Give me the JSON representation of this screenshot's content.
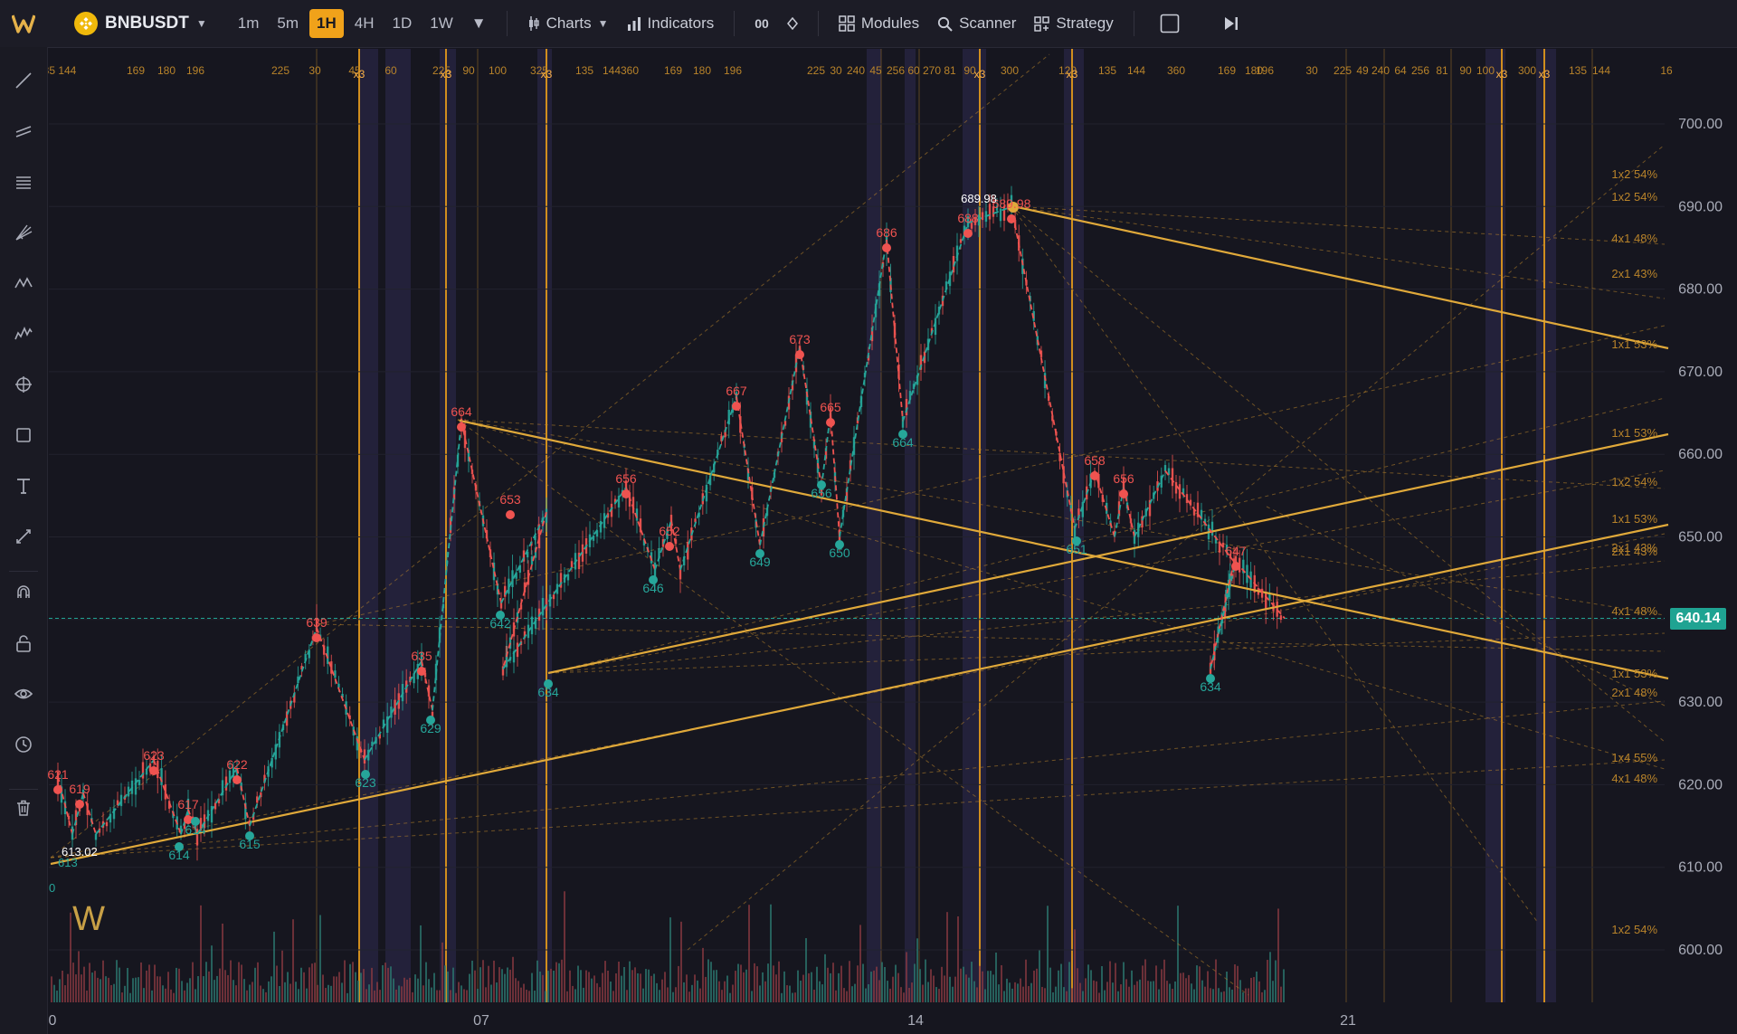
{
  "symbol": "BNBUSDT",
  "timeframes": [
    "1m",
    "5m",
    "1H",
    "4H",
    "1D",
    "1W"
  ],
  "active_timeframe": "1H",
  "toolbar": {
    "charts_label": "Charts",
    "indicators_label": "Indicators",
    "compare_glyph": "00",
    "modules_label": "Modules",
    "scanner_label": "Scanner",
    "strategy_label": "Strategy"
  },
  "sidebar_icons": [
    "trend-line-icon",
    "parallel-channel-icon",
    "horizontal-lines-icon",
    "pitchfork-icon",
    "zigzag-pattern-icon",
    "wave-pattern-icon",
    "crosshair-icon",
    "rectangle-icon",
    "text-tool-icon",
    "measure-icon",
    "magnet-icon",
    "lock-icon",
    "visibility-icon",
    "clock-icon",
    "trash-icon"
  ],
  "colors": {
    "background": "#16161f",
    "accent_orange": "#f0a21a",
    "bull": "#26a69a",
    "bear": "#ef5350",
    "price_badge": "#1fa392",
    "gann_label": "#b8832a"
  },
  "watermark_logo": "W",
  "current_price": "640.14",
  "chart_data": {
    "type": "line",
    "price_axis": [
      "700.00",
      "690.00",
      "680.00",
      "670.00",
      "660.00",
      "650.00",
      "640.00",
      "630.00",
      "620.00",
      "610.00",
      "600.00"
    ],
    "price_range": [
      597,
      706
    ],
    "date_axis": [
      "0",
      "07",
      "14",
      "21"
    ],
    "top_cycle_labels": [
      "35 144",
      "169",
      "180",
      "196",
      "225",
      "30",
      "45",
      "60",
      "225",
      "90",
      "100",
      "325",
      "135",
      "144",
      "360",
      "169",
      "180",
      "196",
      "225",
      "30",
      "240",
      "45",
      "256",
      "60",
      "270",
      "81",
      "90",
      "300",
      "120",
      "135",
      "144",
      "360",
      "169",
      "180",
      "196",
      "30",
      "225",
      "49",
      "240",
      "64",
      "256",
      "81",
      "90",
      "100",
      "300",
      "135",
      "144",
      "16"
    ],
    "x3_markers": [
      "x3",
      "x3",
      "x3",
      "x3",
      "x3",
      "x3",
      "x3"
    ],
    "high_label": "689.98",
    "low_label": "613.02",
    "left_edge_label": "0",
    "partial_low_label": "613",
    "pivot_labels": [
      {
        "label": "621",
        "type": "high"
      },
      {
        "label": "619",
        "type": "high"
      },
      {
        "label": "614",
        "type": "low"
      },
      {
        "label": "623",
        "type": "high"
      },
      {
        "label": "617",
        "type": "high"
      },
      {
        "label": "614",
        "type": "low"
      },
      {
        "label": "622",
        "type": "high"
      },
      {
        "label": "615",
        "type": "low"
      },
      {
        "label": "639",
        "type": "high"
      },
      {
        "label": "623",
        "type": "low"
      },
      {
        "label": "635",
        "type": "high"
      },
      {
        "label": "629",
        "type": "low"
      },
      {
        "label": "664",
        "type": "high"
      },
      {
        "label": "642",
        "type": "low"
      },
      {
        "label": "653",
        "type": "high"
      },
      {
        "label": "634",
        "type": "low"
      },
      {
        "label": "656",
        "type": "high"
      },
      {
        "label": "646",
        "type": "low"
      },
      {
        "label": "652",
        "type": "high"
      },
      {
        "label": "667",
        "type": "high"
      },
      {
        "label": "649",
        "type": "low"
      },
      {
        "label": "673",
        "type": "high"
      },
      {
        "label": "656",
        "type": "low"
      },
      {
        "label": "665",
        "type": "high"
      },
      {
        "label": "650",
        "type": "low"
      },
      {
        "label": "686",
        "type": "high"
      },
      {
        "label": "664",
        "type": "low"
      },
      {
        "label": "688",
        "type": "high"
      },
      {
        "label": "689.98",
        "type": "high"
      },
      {
        "label": "651",
        "type": "low"
      },
      {
        "label": "658",
        "type": "high"
      },
      {
        "label": "656",
        "type": "high"
      },
      {
        "label": "647",
        "type": "high"
      },
      {
        "label": "634",
        "type": "low"
      }
    ],
    "gann_labels": [
      "1x2 54%",
      "1x2 54%",
      "4x1 48%",
      "2x1 43%",
      "1x1 53%",
      "1x1 53%",
      "1x2 54%",
      "1x1 53%",
      "2x1 43%",
      "2x1 43%",
      "4x1 48%",
      "1x1 53%",
      "2x1 48%",
      "1x4 55%",
      "4x1 48%",
      "1x2 54%"
    ],
    "zigzag_prices": [
      621,
      614,
      619,
      614,
      623,
      614,
      617,
      614,
      622,
      615,
      639,
      623,
      635,
      629,
      664,
      642,
      653,
      634,
      656,
      646,
      652,
      646,
      667,
      649,
      673,
      656,
      665,
      650,
      686,
      664,
      688,
      689.98,
      651,
      658,
      650,
      656,
      650,
      658,
      647,
      634,
      647,
      640.14
    ]
  }
}
